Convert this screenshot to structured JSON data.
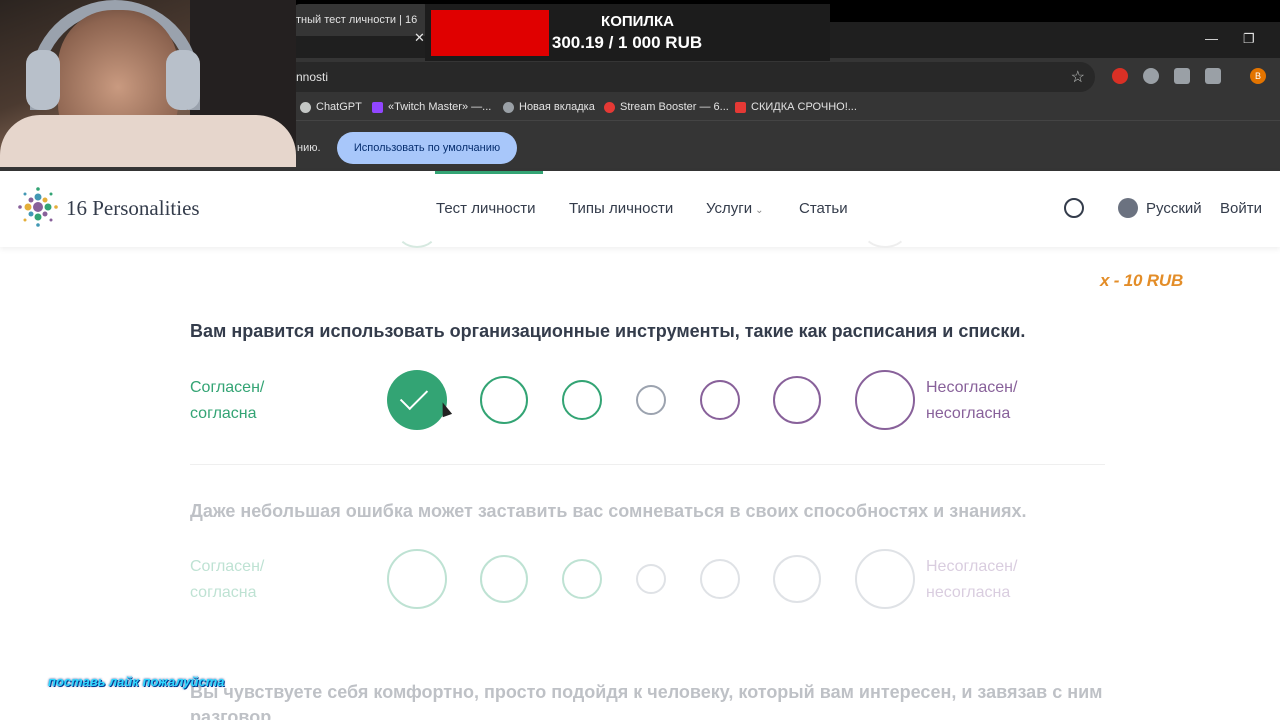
{
  "browser": {
    "tab_title": "тный тест личности | 16",
    "url_fragment": "nnosti",
    "bookmarks": [
      "ChatGPT",
      "«Twitch Master» —...",
      "Новая вкладка",
      "Stream Booster — 6...",
      "СКИДКА СРОЧНО!..."
    ],
    "info_text": "нию.",
    "default_button": "Использовать по умолчанию"
  },
  "overlay": {
    "piggy_title": "КОПИЛКА",
    "piggy_amount": "300.19 / 1 000 RUB",
    "donation_note": "x - 10 RUB",
    "like_note": "поставь лайк пожалуйста"
  },
  "site": {
    "logo": "16 Personalities",
    "nav": {
      "test": "Тест личности",
      "types": "Типы личности",
      "services": "Услуги",
      "articles": "Статьи"
    },
    "language": "Русский",
    "login": "Войти"
  },
  "questions": [
    {
      "text": "Вам нравится использовать организационные инструменты, такие как расписания и списки.",
      "agree": "Согласен/ согласна",
      "disagree": "Несогласен/ несогласна",
      "selected_option": 1
    },
    {
      "text": "Даже небольшая ошибка может заставить вас сомневаться в своих способностях и знаниях.",
      "agree": "Согласен/ согласна",
      "disagree": "Несогласен/ несогласна",
      "selected_option": null
    },
    {
      "text": "Вы чувствуете себя комфортно, просто подойдя к человеку, который вам интересен, и завязав с ним разговор."
    }
  ],
  "colors": {
    "agree": "#33a474",
    "disagree": "#88619a",
    "neutral": "#9ca3af",
    "accent_progress": "#33a474"
  }
}
